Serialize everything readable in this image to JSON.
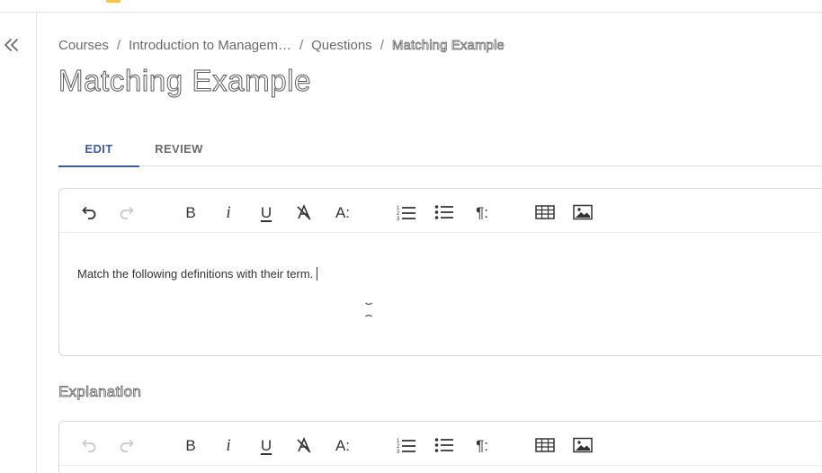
{
  "sidebar": {
    "collapse_icon": "double-chevron-left-icon"
  },
  "breadcrumb": {
    "items": [
      "Courses",
      "Introduction to Managem…",
      "Questions"
    ],
    "current": "Matching Example",
    "separator": "/"
  },
  "page": {
    "title": "Matching Example"
  },
  "tabs": [
    {
      "label": "EDIT",
      "active": true
    },
    {
      "label": "REVIEW",
      "active": false
    }
  ],
  "toolbar": {
    "buttons": [
      {
        "icon": "undo-icon"
      },
      {
        "icon": "redo-icon"
      },
      {
        "icon": "bold-icon",
        "label": "B"
      },
      {
        "icon": "italic-icon",
        "label": "i"
      },
      {
        "icon": "underline-icon",
        "label": "U"
      },
      {
        "icon": "clear-formatting-icon"
      },
      {
        "icon": "text-style-icon",
        "label": "A:"
      },
      {
        "icon": "numbered-list-icon"
      },
      {
        "icon": "bulleted-list-icon"
      },
      {
        "icon": "paragraph-icon",
        "label": "¶:"
      },
      {
        "icon": "table-icon"
      },
      {
        "icon": "image-icon"
      }
    ]
  },
  "question_editor": {
    "content": "Match the following definitions with their term."
  },
  "explanation": {
    "heading": "Explanation"
  },
  "colors": {
    "accent": "#3f5b9a",
    "border": "#d8d8d8",
    "text": "#333333",
    "muted": "#6a6a6a",
    "disabled": "#c9c9c9"
  }
}
